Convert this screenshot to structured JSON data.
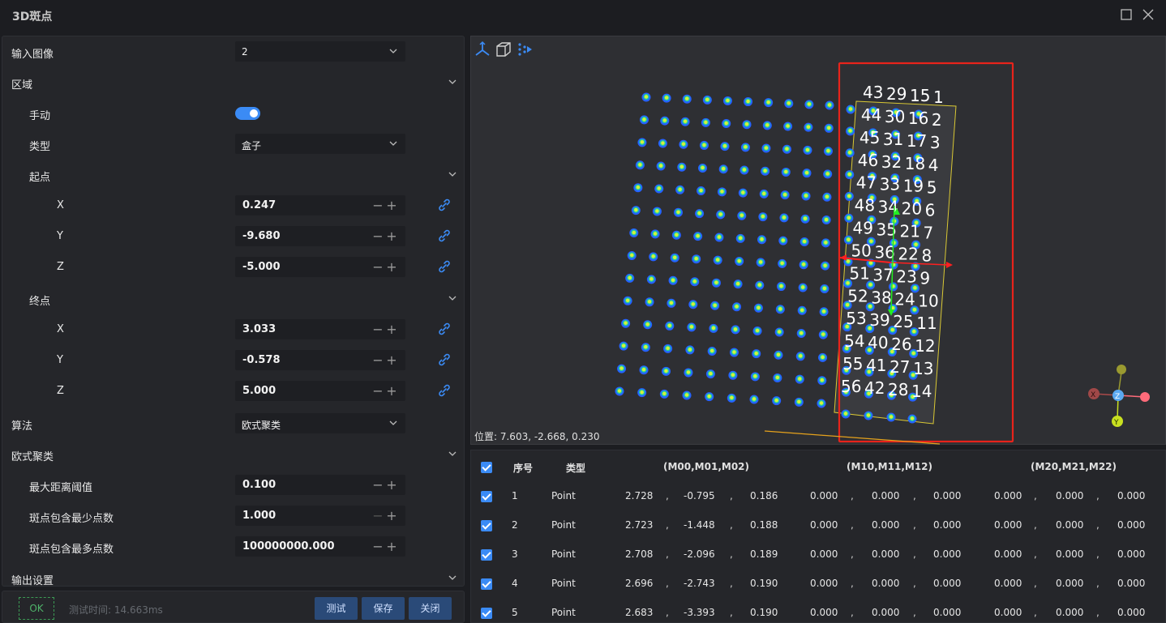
{
  "window": {
    "title": "3D斑点"
  },
  "left_panel": {
    "input_image": {
      "label": "输入图像",
      "value": "2"
    },
    "region": {
      "label": "区域"
    },
    "manual": {
      "label": "手动",
      "on": true
    },
    "type": {
      "label": "类型",
      "value": "盒子"
    },
    "start": {
      "label": "起点",
      "x": {
        "label": "X",
        "value": "0.247"
      },
      "y": {
        "label": "Y",
        "value": "-9.680"
      },
      "z": {
        "label": "Z",
        "value": "-5.000"
      }
    },
    "end": {
      "label": "终点",
      "x": {
        "label": "X",
        "value": "3.033"
      },
      "y": {
        "label": "Y",
        "value": "-0.578"
      },
      "z": {
        "label": "Z",
        "value": "5.000"
      }
    },
    "algorithm": {
      "label": "算法",
      "value": "欧式聚类"
    },
    "euclid": {
      "label": "欧式聚类",
      "max_dist": {
        "label": "最大距离阈值",
        "value": "0.100"
      },
      "min_pts": {
        "label": "斑点包含最少点数",
        "value": "1.000"
      },
      "max_pts": {
        "label": "斑点包含最多点数",
        "value": "100000000.000"
      }
    },
    "output": {
      "label": "输出设置"
    }
  },
  "footer": {
    "status": "OK",
    "test_time": "测试时间: 14.663ms",
    "test_btn": "测试",
    "save_btn": "保存",
    "close_btn": "关闭"
  },
  "viewer": {
    "position_label": "位置: 7.603, -2.668, 0.230",
    "blob_labels": [
      {
        "n": "43"
      },
      {
        "n": "29"
      },
      {
        "n": "15"
      },
      {
        "n": "1"
      },
      {
        "n": "44"
      },
      {
        "n": "30"
      },
      {
        "n": "16"
      },
      {
        "n": "2"
      },
      {
        "n": "45"
      },
      {
        "n": "31"
      },
      {
        "n": "17"
      },
      {
        "n": "3"
      },
      {
        "n": "46"
      },
      {
        "n": "32"
      },
      {
        "n": "18"
      },
      {
        "n": "4"
      },
      {
        "n": "47"
      },
      {
        "n": "33"
      },
      {
        "n": "19"
      },
      {
        "n": "5"
      },
      {
        "n": "48"
      },
      {
        "n": "34"
      },
      {
        "n": "20"
      },
      {
        "n": "6"
      },
      {
        "n": "49"
      },
      {
        "n": "35"
      },
      {
        "n": "21"
      },
      {
        "n": "7"
      },
      {
        "n": "50"
      },
      {
        "n": "36"
      },
      {
        "n": "22"
      },
      {
        "n": "8"
      },
      {
        "n": "51"
      },
      {
        "n": "37"
      },
      {
        "n": "23"
      },
      {
        "n": "9"
      },
      {
        "n": "52"
      },
      {
        "n": "38"
      },
      {
        "n": "24"
      },
      {
        "n": "10"
      },
      {
        "n": "53"
      },
      {
        "n": "39"
      },
      {
        "n": "25"
      },
      {
        "n": "11"
      },
      {
        "n": "54"
      },
      {
        "n": "40"
      },
      {
        "n": "26"
      },
      {
        "n": "12"
      },
      {
        "n": "55"
      },
      {
        "n": "41"
      },
      {
        "n": "27"
      },
      {
        "n": "13"
      },
      {
        "n": "56"
      },
      {
        "n": "42"
      },
      {
        "n": "28"
      },
      {
        "n": "14"
      }
    ],
    "axis_labels": {
      "x": "X",
      "y": "Y",
      "z": "Z"
    },
    "colors": {
      "roi_box": "#e8231b",
      "yellow_box": "#d9c834",
      "dot_outer": "#2563ff",
      "dot_inner": "#d7f03a"
    }
  },
  "table": {
    "headers": {
      "index": "序号",
      "type": "类型",
      "m0": "(M00,M01,M02)",
      "m1": "(M10,M11,M12)",
      "m2": "(M20,M21,M22)"
    },
    "rows": [
      {
        "idx": "1",
        "type": "Point",
        "v": [
          "2.728",
          "-0.795",
          "0.186",
          "0.000",
          "0.000",
          "0.000",
          "0.000",
          "0.000",
          "0.000"
        ]
      },
      {
        "idx": "2",
        "type": "Point",
        "v": [
          "2.723",
          "-1.448",
          "0.188",
          "0.000",
          "0.000",
          "0.000",
          "0.000",
          "0.000",
          "0.000"
        ]
      },
      {
        "idx": "3",
        "type": "Point",
        "v": [
          "2.708",
          "-2.096",
          "0.189",
          "0.000",
          "0.000",
          "0.000",
          "0.000",
          "0.000",
          "0.000"
        ]
      },
      {
        "idx": "4",
        "type": "Point",
        "v": [
          "2.696",
          "-2.743",
          "0.190",
          "0.000",
          "0.000",
          "0.000",
          "0.000",
          "0.000",
          "0.000"
        ]
      },
      {
        "idx": "5",
        "type": "Point",
        "v": [
          "2.683",
          "-3.393",
          "0.190",
          "0.000",
          "0.000",
          "0.000",
          "0.000",
          "0.000",
          "0.000"
        ]
      }
    ]
  }
}
